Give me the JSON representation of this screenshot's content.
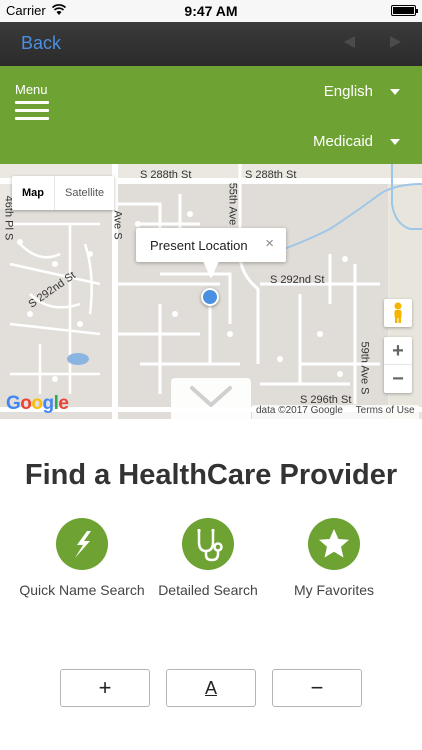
{
  "status_bar": {
    "carrier": "Carrier",
    "time": "9:47 AM"
  },
  "nav": {
    "back_label": "Back"
  },
  "header": {
    "menu_label": "Menu",
    "language": "English",
    "plan": "Medicaid",
    "color": "#6ea333"
  },
  "map": {
    "map_type_options": [
      "Map",
      "Satellite"
    ],
    "info_window_text": "Present Location",
    "close_glyph": "×",
    "zoom_in": "+",
    "zoom_out": "−",
    "google_logo": "Google",
    "attribution": "data ©2017 Google",
    "terms": "Terms of Use",
    "street_labels": [
      "S 288th St",
      "S 288th St",
      "46th Pl S",
      "Ave S",
      "55th Ave",
      "S 292nd St",
      "S 292nd St",
      "59th Ave S",
      "S 296th St"
    ]
  },
  "main": {
    "title": "Find a HealthCare Provider",
    "features": [
      {
        "label": "Quick Name Search",
        "icon": "lightning-icon"
      },
      {
        "label": "Detailed Search",
        "icon": "stethoscope-icon"
      },
      {
        "label": "My Favorites",
        "icon": "star-icon"
      }
    ],
    "text_size_controls": {
      "increase": "+",
      "default": "A",
      "decrease": "−"
    }
  }
}
